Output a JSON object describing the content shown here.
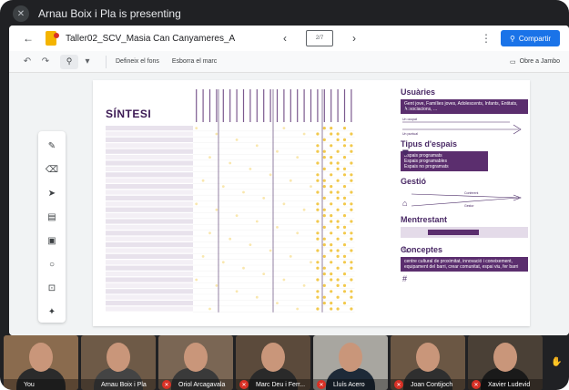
{
  "presenter_bar": {
    "text": "Arnau Boix i Pla is presenting"
  },
  "app": {
    "doc_title": "Taller02_SCV_Masia Can Canyameres_A",
    "page_indicator": "2/7",
    "share_label": "Compartir",
    "toolbar": {
      "background_label": "Defineix el fons",
      "clear_frame_label": "Esborra el marc",
      "open_label": "Obre a Jambo"
    }
  },
  "slide": {
    "title": "SÍNTESI",
    "sections": {
      "usuaries": {
        "heading": "Usuàries",
        "box_text": "Gent jove, Famílies joves, Adolescents, Infants, Entitats, Associacions, ...",
        "scale_low": "Un ocupat",
        "scale_high": "Un puntual"
      },
      "tipus": {
        "heading": "Tipus d'espais",
        "items": [
          "Espais programats",
          "Espais programables",
          "Espais no programats"
        ]
      },
      "gestio": {
        "heading": "Gestió",
        "label_top": "Conferent",
        "label_bottom": "Gestor"
      },
      "mentrestant": {
        "heading": "Mentrestant"
      },
      "conceptes": {
        "heading": "Conceptes",
        "box_text": "centre cultural de proximitat, innovació i coneixement, equipament del barri, crear comunitat, espai viu, fer barri"
      }
    }
  },
  "participants": [
    {
      "name": "You",
      "muted": false,
      "bg": "#8a6b4e",
      "shirt": "#2b2b2b"
    },
    {
      "name": "Arnau Boix i Pla",
      "muted": false,
      "bg": "#6e5a47",
      "shirt": "#444444"
    },
    {
      "name": "Oriol Arcagavala",
      "muted": true,
      "bg": "#7a6654",
      "shirt": "#3a3a3a"
    },
    {
      "name": "Marc Deu i Ferr...",
      "muted": true,
      "bg": "#5b4a3b",
      "shirt": "#2a2a2a"
    },
    {
      "name": "Lluís Acero",
      "muted": true,
      "bg": "#a8a6a0",
      "shirt": "#1e2a38"
    },
    {
      "name": "Joan Contijoch",
      "muted": true,
      "bg": "#6b5744",
      "shirt": "#2f2f2f"
    },
    {
      "name": "Xavier Ludevid",
      "muted": true,
      "bg": "#4a4036",
      "shirt": "#1a1a1a"
    }
  ],
  "colors": {
    "accent": "#1a73e8",
    "slide_purple": "#5b2e6e",
    "dot_yellow": "#f2c94c",
    "mute_red": "#d93025"
  }
}
